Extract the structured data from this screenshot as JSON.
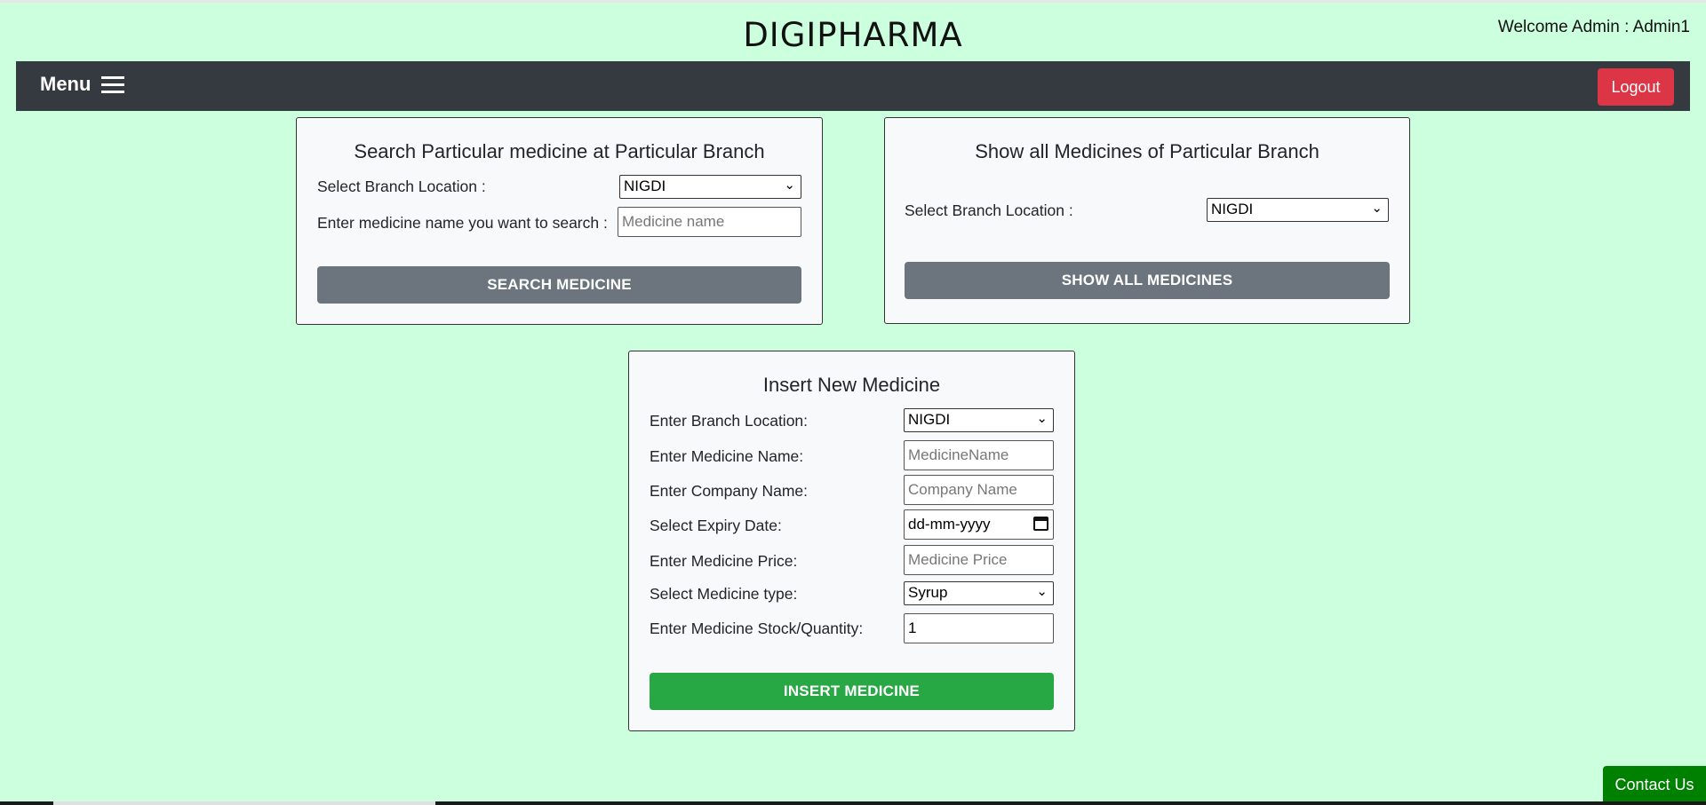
{
  "header": {
    "brand": "DIGIPHARMA",
    "welcome": "Welcome Admin : Admin1"
  },
  "navbar": {
    "menu_label": "Menu",
    "menu_icon": "hamburger-icon",
    "logout_label": "Logout"
  },
  "search_card": {
    "title": "Search Particular medicine at Particular Branch",
    "branch_label": "Select Branch Location :",
    "branch_value": "NIGDI",
    "medicine_label": "Enter medicine name you want to search :",
    "medicine_placeholder": "Medicine name",
    "button_label": "SEARCH MEDICINE"
  },
  "show_all_card": {
    "title": "Show all Medicines of Particular Branch",
    "branch_label": "Select Branch Location :",
    "branch_value": "NIGDI",
    "button_label": "SHOW ALL MEDICINES"
  },
  "insert_card": {
    "title": "Insert New Medicine",
    "branch_label": "Enter Branch Location:",
    "branch_value": "NIGDI",
    "name_label": "Enter Medicine Name:",
    "name_placeholder": "MedicineName",
    "company_label": "Enter Company Name:",
    "company_placeholder": "Company Name",
    "expiry_label": "Select Expiry Date:",
    "expiry_value": "dd-mm-yyyy",
    "price_label": "Enter Medicine Price:",
    "price_placeholder": "Medicine Price",
    "type_label": "Select Medicine type:",
    "type_value": "Syrup",
    "stock_label": "Enter Medicine Stock/Quantity:",
    "stock_value": "1",
    "button_label": "INSERT MEDICINE"
  },
  "footer": {
    "contact_label": "Contact Us"
  },
  "colors": {
    "background": "#ccffdd",
    "navbar": "#343a40",
    "logout": "#dc3545",
    "grey_button": "#6c757d",
    "insert_button": "#28a745",
    "contact_button": "#008000"
  }
}
